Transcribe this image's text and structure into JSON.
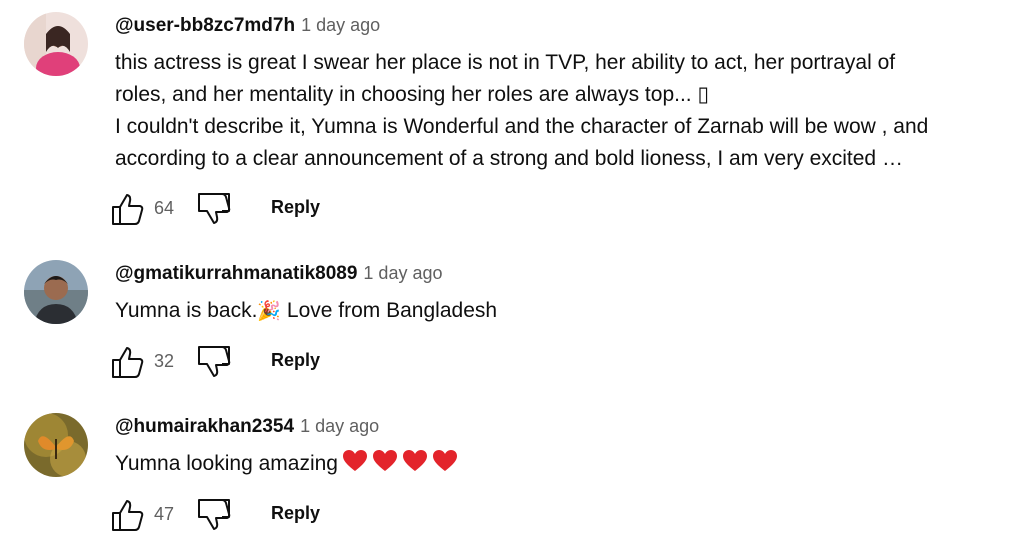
{
  "comments": [
    {
      "handle": "@user-bb8zc7md7h",
      "time": "1 day ago",
      "lines": [
        "this actress is great  I swear her place is not in  TVP, her ability to act, her portrayal of",
        "roles, and her mentality in choosing her roles are always top... ▯",
        " I couldn't describe it, Yumna is Wonderful and the character of Zarnab will be wow , and",
        "according to a clear announcement of a strong and bold lioness, I am very excited …"
      ],
      "likes": "64",
      "reply_label": "Reply"
    },
    {
      "handle": "@gmatikurrahmanatik8089",
      "time": "1 day ago",
      "text_before": "Yumna is back.",
      "emoji": "🎉",
      "text_after": " Love from Bangladesh",
      "likes": "32",
      "reply_label": "Reply"
    },
    {
      "handle": "@humairakhan2354",
      "time": "1 day ago",
      "text": "Yumna looking amazing",
      "hearts": 4,
      "likes": "47",
      "reply_label": "Reply"
    }
  ],
  "icons": {
    "like": "thumbs-up-icon",
    "dislike": "thumbs-down-icon",
    "heart": "red-heart-icon",
    "party": "party-popper-icon"
  },
  "colors": {
    "text": "#0f0f0f",
    "secondary": "#606060",
    "heart": "#e3242b"
  }
}
